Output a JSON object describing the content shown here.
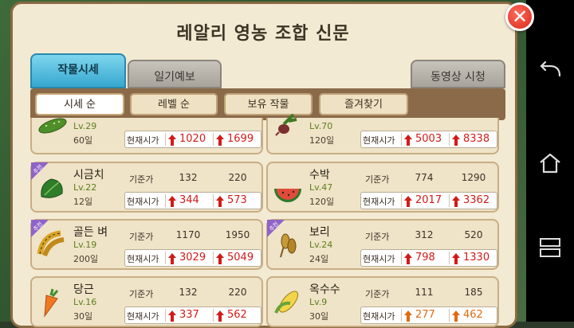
{
  "title": "레알리 영농 조합 신문",
  "tabs": [
    {
      "label": "작물시세"
    },
    {
      "label": "일기예보"
    },
    {
      "label": "동영상 시청"
    }
  ],
  "filters": [
    {
      "label": "시세 순"
    },
    {
      "label": "레벨 순"
    },
    {
      "label": "보유 작물"
    },
    {
      "label": "즐겨찾기"
    }
  ],
  "common": {
    "base_label": "기준가",
    "current_label": "현재시가",
    "badge_label": "추천"
  },
  "crops": [
    {
      "name": "",
      "lv": "Lv.29",
      "days": "60일",
      "base1": "",
      "base2": "",
      "cur1": "1020",
      "cur2": "1699",
      "recommended": false,
      "icon": "cucumber-icon"
    },
    {
      "name": "",
      "lv": "Lv.70",
      "days": "120일",
      "base1": "",
      "base2": "",
      "cur1": "5003",
      "cur2": "8338",
      "recommended": false,
      "icon": "radish-icon"
    },
    {
      "name": "시금치",
      "lv": "Lv.22",
      "days": "12일",
      "base1": "132",
      "base2": "220",
      "cur1": "344",
      "cur2": "573",
      "recommended": true,
      "icon": "spinach-icon"
    },
    {
      "name": "수박",
      "lv": "Lv.47",
      "days": "120일",
      "base1": "774",
      "base2": "1290",
      "cur1": "2017",
      "cur2": "3362",
      "recommended": false,
      "icon": "watermelon-icon"
    },
    {
      "name": "골든 벼",
      "lv": "Lv.19",
      "days": "200일",
      "base1": "1170",
      "base2": "1950",
      "cur1": "3029",
      "cur2": "5049",
      "recommended": true,
      "icon": "golden-rice-icon"
    },
    {
      "name": "보리",
      "lv": "Lv.24",
      "days": "24일",
      "base1": "312",
      "base2": "520",
      "cur1": "798",
      "cur2": "1330",
      "recommended": true,
      "icon": "barley-icon"
    },
    {
      "name": "당근",
      "lv": "Lv.16",
      "days": "30일",
      "base1": "132",
      "base2": "220",
      "cur1": "337",
      "cur2": "562",
      "recommended": false,
      "icon": "carrot-icon"
    },
    {
      "name": "옥수수",
      "lv": "Lv.9",
      "days": "30일",
      "base1": "111",
      "base2": "185",
      "cur1": "277",
      "cur2": "462",
      "recommended": false,
      "icon": "corn-icon"
    }
  ],
  "colors": {
    "accent": "#36a7cf",
    "price_up": "#d21b16",
    "price_up_orange": "#e06a12",
    "badge": "#8f63c9"
  }
}
